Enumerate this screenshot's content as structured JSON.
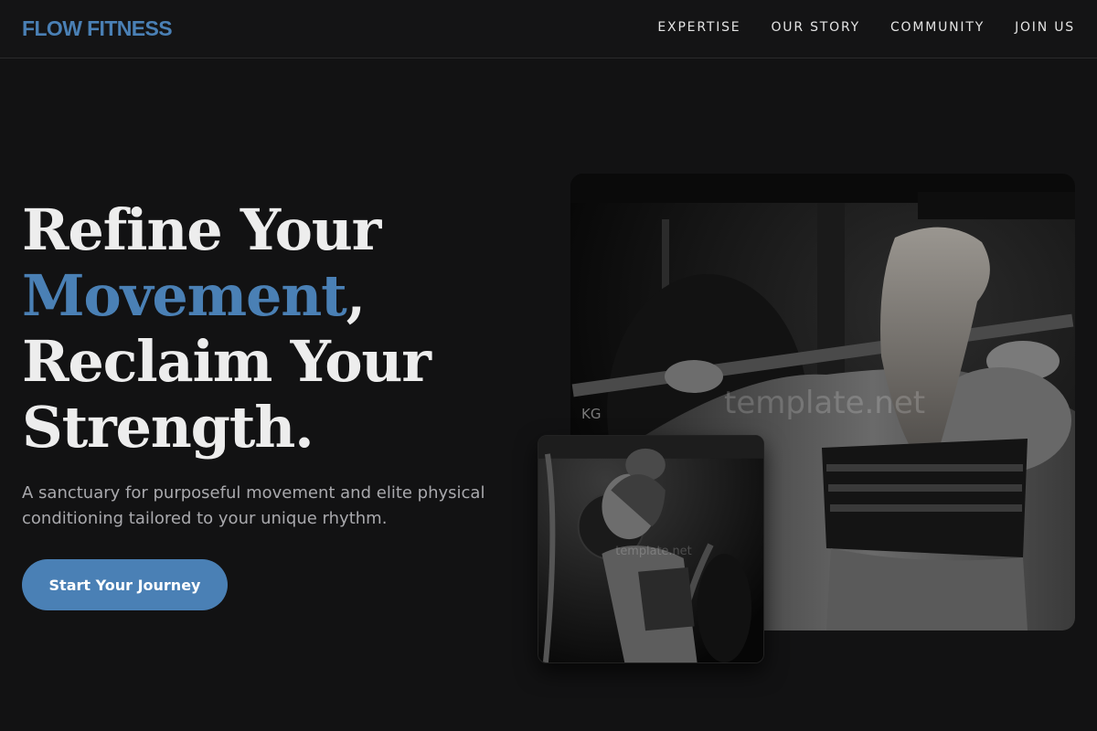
{
  "brand": {
    "logo": "FLOW FITNESS",
    "accent_color": "#4a80b5"
  },
  "nav": {
    "links": [
      "EXPERTISE",
      "OUR STORY",
      "COMMUNITY",
      "JOIN US"
    ]
  },
  "hero": {
    "title_line1": "Refine Your",
    "title_accent": "Movement",
    "title_comma": ",",
    "title_line3": "Reclaim Your",
    "title_line4": "Strength.",
    "subtitle": "A sanctuary for purposeful movement and elite physical conditioning tailored to your unique rhythm.",
    "cta": "Start Your Journey"
  },
  "images": {
    "main_alt": "Woman lifting a barbell on her shoulders, viewed from behind",
    "main_watermark": "template.net",
    "main_plate_text": "KG",
    "small_alt": "Woman in a gym holding a battle rope",
    "small_watermark": "template.net"
  }
}
